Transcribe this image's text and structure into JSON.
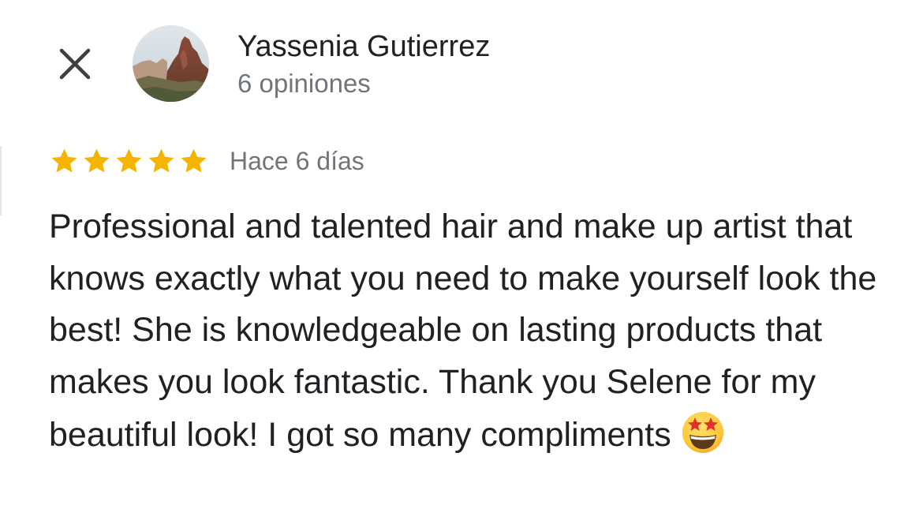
{
  "header": {
    "close_icon": "close-icon"
  },
  "reviewer": {
    "name": "Yassenia Gutierrez",
    "reviews_count": "6 opiniones",
    "avatar_icon": "avatar-desert-rock-photo"
  },
  "review": {
    "rating": 5,
    "rating_max": 5,
    "date": "Hace 6 días",
    "text": "Professional and talented hair and make up artist that knows exactly what you need to make yourself look the best! She is knowledgeable on lasting products that makes you look fantastic. Thank you Selene for my beautiful look! I got so many compliments",
    "emoji_icon": "star-struck-emoji",
    "star_color": "#f4b400"
  }
}
